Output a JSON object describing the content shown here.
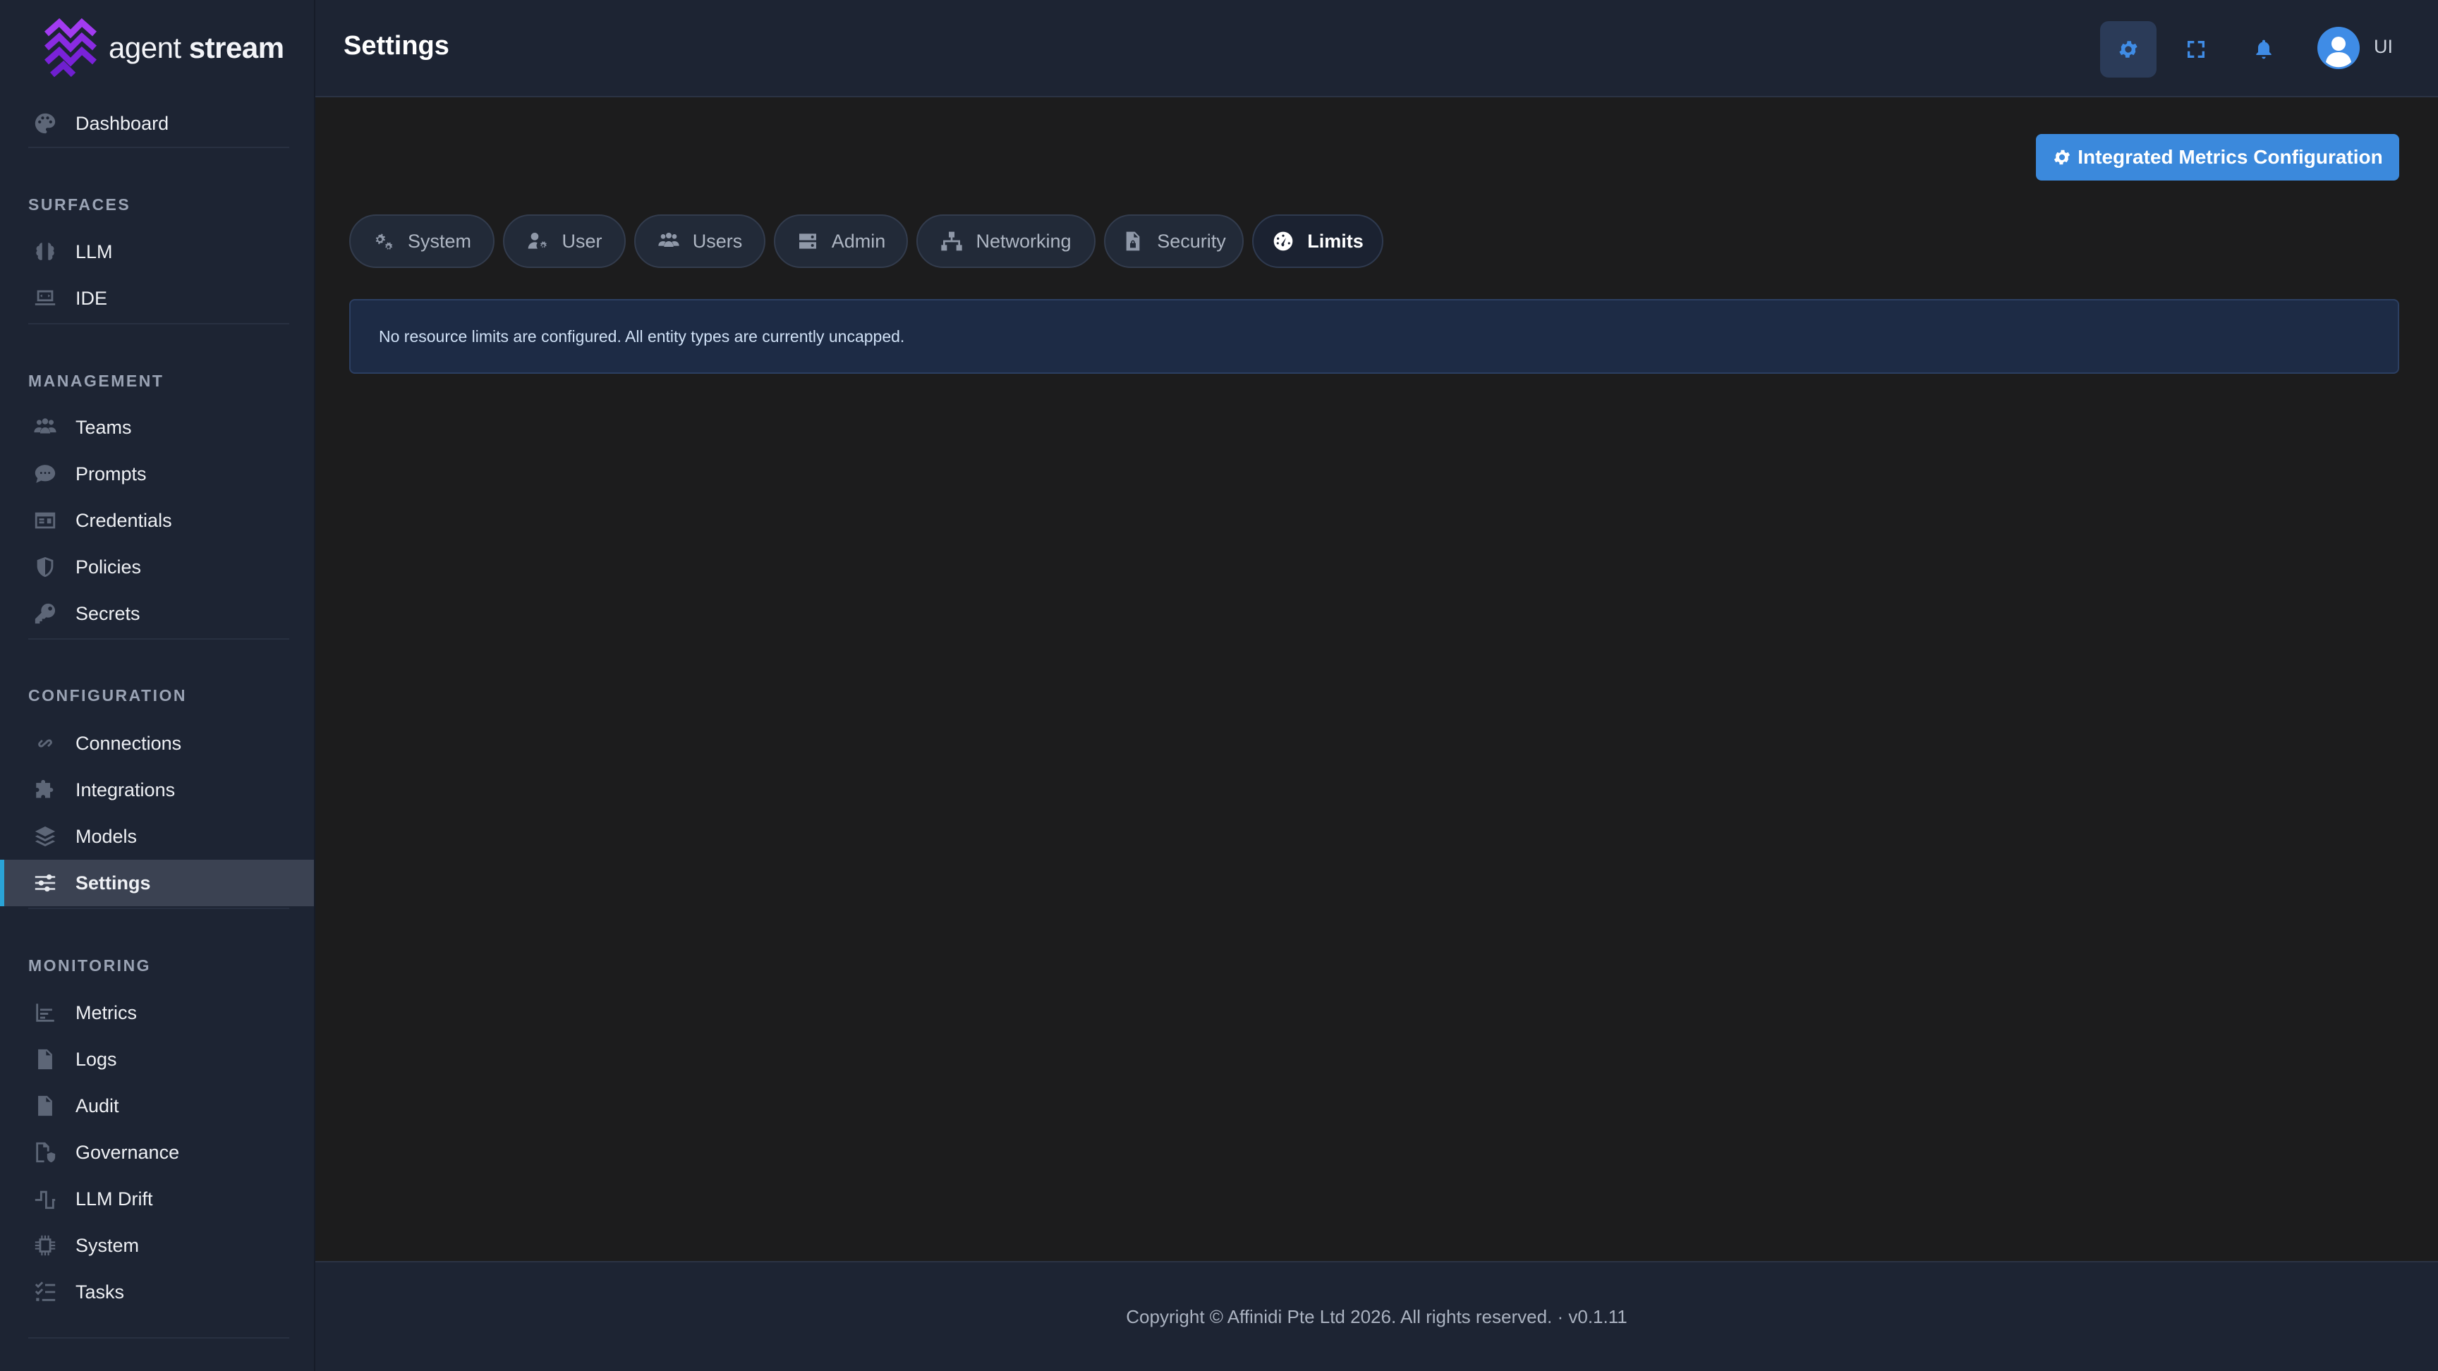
{
  "brand": {
    "light": "agent ",
    "bold": "stream"
  },
  "header": {
    "title": "Settings",
    "user_initials": "UI"
  },
  "sidebar": {
    "dashboard": {
      "label": "Dashboard",
      "icon": "palette-icon"
    },
    "sections": [
      {
        "title": "SURFACES",
        "items": [
          {
            "label": "LLM",
            "icon": "brain-icon"
          },
          {
            "label": "IDE",
            "icon": "laptop-code-icon"
          }
        ]
      },
      {
        "title": "MANAGEMENT",
        "items": [
          {
            "label": "Teams",
            "icon": "users-icon"
          },
          {
            "label": "Prompts",
            "icon": "comment-icon"
          },
          {
            "label": "Credentials",
            "icon": "id-card-icon"
          },
          {
            "label": "Policies",
            "icon": "shield-icon"
          },
          {
            "label": "Secrets",
            "icon": "key-icon"
          }
        ]
      },
      {
        "title": "CONFIGURATION",
        "items": [
          {
            "label": "Connections",
            "icon": "link-icon"
          },
          {
            "label": "Integrations",
            "icon": "puzzle-icon"
          },
          {
            "label": "Models",
            "icon": "layers-icon"
          },
          {
            "label": "Settings",
            "icon": "sliders-icon",
            "active": true
          }
        ]
      },
      {
        "title": "MONITORING",
        "items": [
          {
            "label": "Metrics",
            "icon": "chart-icon"
          },
          {
            "label": "Logs",
            "icon": "file-icon"
          },
          {
            "label": "Audit",
            "icon": "file-lines-icon"
          },
          {
            "label": "Governance",
            "icon": "file-shield-icon"
          },
          {
            "label": "LLM Drift",
            "icon": "wave-square-icon"
          },
          {
            "label": "System",
            "icon": "microchip-icon"
          },
          {
            "label": "Tasks",
            "icon": "list-check-icon"
          }
        ]
      }
    ]
  },
  "main": {
    "metrics_button": "Integrated Metrics Configuration",
    "tabs": [
      {
        "label": "System",
        "icon": "gears-icon"
      },
      {
        "label": "User",
        "icon": "user-gear-icon"
      },
      {
        "label": "Users",
        "icon": "users-icon"
      },
      {
        "label": "Admin",
        "icon": "server-icon"
      },
      {
        "label": "Networking",
        "icon": "network-icon"
      },
      {
        "label": "Security",
        "icon": "file-lock-icon"
      },
      {
        "label": "Limits",
        "icon": "gauge-icon",
        "active": true
      }
    ],
    "alert": "No resource limits are configured. All entity types are currently uncapped."
  },
  "footer": {
    "text": "Copyright © Affinidi Pte Ltd 2026. All rights reserved. · v0.1.11"
  },
  "colors": {
    "accent": "#3b89dc",
    "active_indicator": "#2aa3d6",
    "brand": "#8a2be2"
  }
}
